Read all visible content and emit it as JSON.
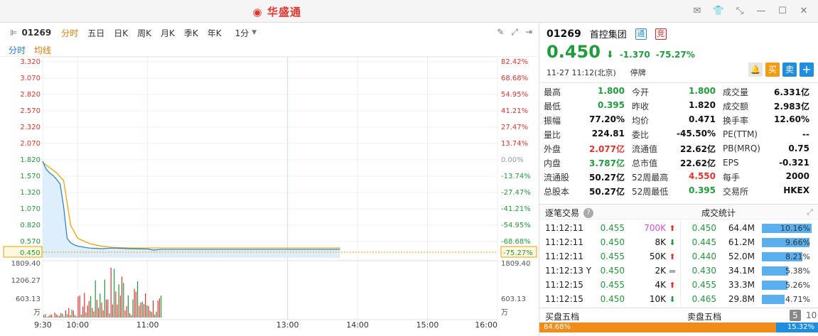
{
  "app": {
    "title": "华盛通"
  },
  "window": {
    "icons": [
      "mail-icon",
      "shirt-icon",
      "shrink-icon",
      "minimize-icon",
      "maximize-icon",
      "close-icon"
    ]
  },
  "toolbar": {
    "code": "01269",
    "periods": [
      "分时",
      "五日",
      "日K",
      "周K",
      "月K",
      "季K",
      "年K"
    ],
    "active_period": "分时",
    "interval": "1分"
  },
  "subtoolbar": {
    "tab1": "分时",
    "tab2": "均线"
  },
  "chart": {
    "price_ticks": [
      "3.320",
      "3.070",
      "2.820",
      "2.570",
      "2.320",
      "2.070",
      "1.820",
      "1.570",
      "1.320",
      "1.070",
      "0.820",
      "0.570"
    ],
    "pct_ticks": [
      "82.42%",
      "68.68%",
      "54.95%",
      "41.21%",
      "27.47%",
      "13.74%",
      "0.00%",
      "-13.74%",
      "-27.47%",
      "-41.21%",
      "-54.95%",
      "-68.68%"
    ],
    "current_price_label": "0.450",
    "current_pct_label": "-75.27%",
    "vol_ticks": [
      "1809.40",
      "1206.27",
      "603.13"
    ],
    "vol_unit": "万",
    "vol_right_ticks": [
      "1809.40",
      "603.13"
    ],
    "vol_right_unit": "万",
    "time_ticks": [
      "9:30",
      "10:00",
      "11:00",
      "13:00",
      "14:00",
      "15:00",
      "16:00"
    ],
    "colors": {
      "price_line": "#1f7fd0",
      "avg_line": "#f0a500",
      "up": "#e8322c",
      "down": "#1f9c3b",
      "area": "#dfeefb"
    }
  },
  "chart_data": {
    "type": "line",
    "series": [
      {
        "name": "分时",
        "x": [
          "9:30",
          "9:33",
          "9:36",
          "9:39",
          "9:42",
          "9:45",
          "9:48",
          "9:51",
          "9:54",
          "9:57",
          "10:00",
          "10:10",
          "10:20",
          "10:30",
          "10:45",
          "11:00",
          "11:05",
          "11:12",
          "12:00",
          "13:00",
          "13:45"
        ],
        "values": [
          1.8,
          1.68,
          1.62,
          1.58,
          1.52,
          1.45,
          1.1,
          0.62,
          0.55,
          0.52,
          0.5,
          0.47,
          0.46,
          0.47,
          0.46,
          0.455,
          0.44,
          0.45,
          0.45,
          0.45,
          0.45
        ]
      },
      {
        "name": "均线",
        "x": [
          "9:30",
          "9:36",
          "9:42",
          "9:48",
          "9:54",
          "10:00",
          "10:10",
          "10:20",
          "10:30",
          "10:45",
          "11:00",
          "11:12",
          "12:00",
          "13:00",
          "13:45"
        ],
        "values": [
          1.78,
          1.7,
          1.62,
          1.5,
          0.82,
          0.62,
          0.54,
          0.5,
          0.48,
          0.47,
          0.471,
          0.471,
          0.471,
          0.471,
          0.471
        ]
      }
    ],
    "ylim": [
      0.32,
      3.32
    ]
  },
  "stock": {
    "code": "01269",
    "name": "首控集团",
    "tag_tong": "通",
    "tag_gang": "竞",
    "price": "0.450",
    "change": "-1.370",
    "change_pct": "-75.27%",
    "date": "11-27",
    "time": "11:12(北京)",
    "status": "停牌",
    "buy_label": "买",
    "sell_label": "卖",
    "add_label": "+"
  },
  "stats": [
    [
      {
        "label": "最高",
        "value": "1.800",
        "color": "green"
      },
      {
        "label": "今开",
        "value": "1.800",
        "color": "green"
      },
      {
        "label": "成交量",
        "value": "6.331亿",
        "color": "black"
      }
    ],
    [
      {
        "label": "最低",
        "value": "0.395",
        "color": "green"
      },
      {
        "label": "昨收",
        "value": "1.820",
        "color": "black"
      },
      {
        "label": "成交额",
        "value": "2.983亿",
        "color": "black"
      }
    ],
    [
      {
        "label": "振幅",
        "value": "77.20%",
        "color": "black"
      },
      {
        "label": "均价",
        "value": "0.471",
        "color": "black"
      },
      {
        "label": "换手率",
        "value": "12.60%",
        "color": "black"
      }
    ],
    [
      {
        "label": "量比",
        "value": "224.81",
        "color": "black"
      },
      {
        "label": "委比",
        "value": "-45.50%",
        "color": "black"
      },
      {
        "label": "PE(TTM)",
        "value": "--",
        "color": "black"
      }
    ],
    [
      {
        "label": "外盘",
        "value": "2.077亿",
        "color": "red"
      },
      {
        "label": "流通值",
        "value": "22.62亿",
        "color": "black"
      },
      {
        "label": "PB(MRQ)",
        "value": "0.75",
        "color": "black"
      }
    ],
    [
      {
        "label": "内盘",
        "value": "3.787亿",
        "color": "green"
      },
      {
        "label": "总市值",
        "value": "22.62亿",
        "color": "black"
      },
      {
        "label": "EPS",
        "value": "-0.321",
        "color": "black"
      }
    ],
    [
      {
        "label": "流通股",
        "value": "50.27亿",
        "color": "black"
      },
      {
        "label": "52周最高",
        "value": "4.550",
        "color": "red"
      },
      {
        "label": "每手",
        "value": "2000",
        "color": "black"
      }
    ],
    [
      {
        "label": "总股本",
        "value": "50.27亿",
        "color": "black"
      },
      {
        "label": "52周最低",
        "value": "0.395",
        "color": "green"
      },
      {
        "label": "交易所",
        "value": "HKEX",
        "color": "black"
      }
    ]
  ],
  "trades_section": {
    "title": "逐笔交易",
    "help": "?",
    "stats_title": "成交统计"
  },
  "trades": [
    {
      "time": "11:12:11",
      "price": "0.455",
      "vol": "700K",
      "dir": "up",
      "vol_color": "#d24fd2"
    },
    {
      "time": "11:12:11",
      "price": "0.450",
      "vol": "8K",
      "dir": "down",
      "vol_color": "#111"
    },
    {
      "time": "11:12:11",
      "price": "0.455",
      "vol": "50K",
      "dir": "up",
      "vol_color": "#111"
    },
    {
      "time": "11:12:13 Y",
      "price": "0.450",
      "vol": "2K",
      "dir": "flat",
      "vol_color": "#111"
    },
    {
      "time": "11:12:15",
      "price": "0.455",
      "vol": "4K",
      "dir": "up",
      "vol_color": "#111"
    },
    {
      "time": "11:12:15",
      "price": "0.450",
      "vol": "10K",
      "dir": "down",
      "vol_color": "#111"
    }
  ],
  "vol_stats": [
    {
      "price": "0.450",
      "vol": "64.4M",
      "pct": "10.16%",
      "ratio": 1.0
    },
    {
      "price": "0.445",
      "vol": "61.2M",
      "pct": "9.66%",
      "ratio": 0.95
    },
    {
      "price": "0.440",
      "vol": "52.0M",
      "pct": "8.21%",
      "ratio": 0.81
    },
    {
      "price": "0.430",
      "vol": "34.1M",
      "pct": "5.38%",
      "ratio": 0.53
    },
    {
      "price": "0.455",
      "vol": "33.3M",
      "pct": "5.26%",
      "ratio": 0.52
    },
    {
      "price": "0.465",
      "vol": "29.8M",
      "pct": "4.71%",
      "ratio": 0.46
    }
  ],
  "depth": {
    "buy_title": "买盘五档",
    "sell_title": "卖盘五档",
    "five": "5",
    "ten": "10",
    "buy_pct": "84.68%",
    "sell_pct": "15.32%",
    "buy_ratio": 0.8468
  }
}
